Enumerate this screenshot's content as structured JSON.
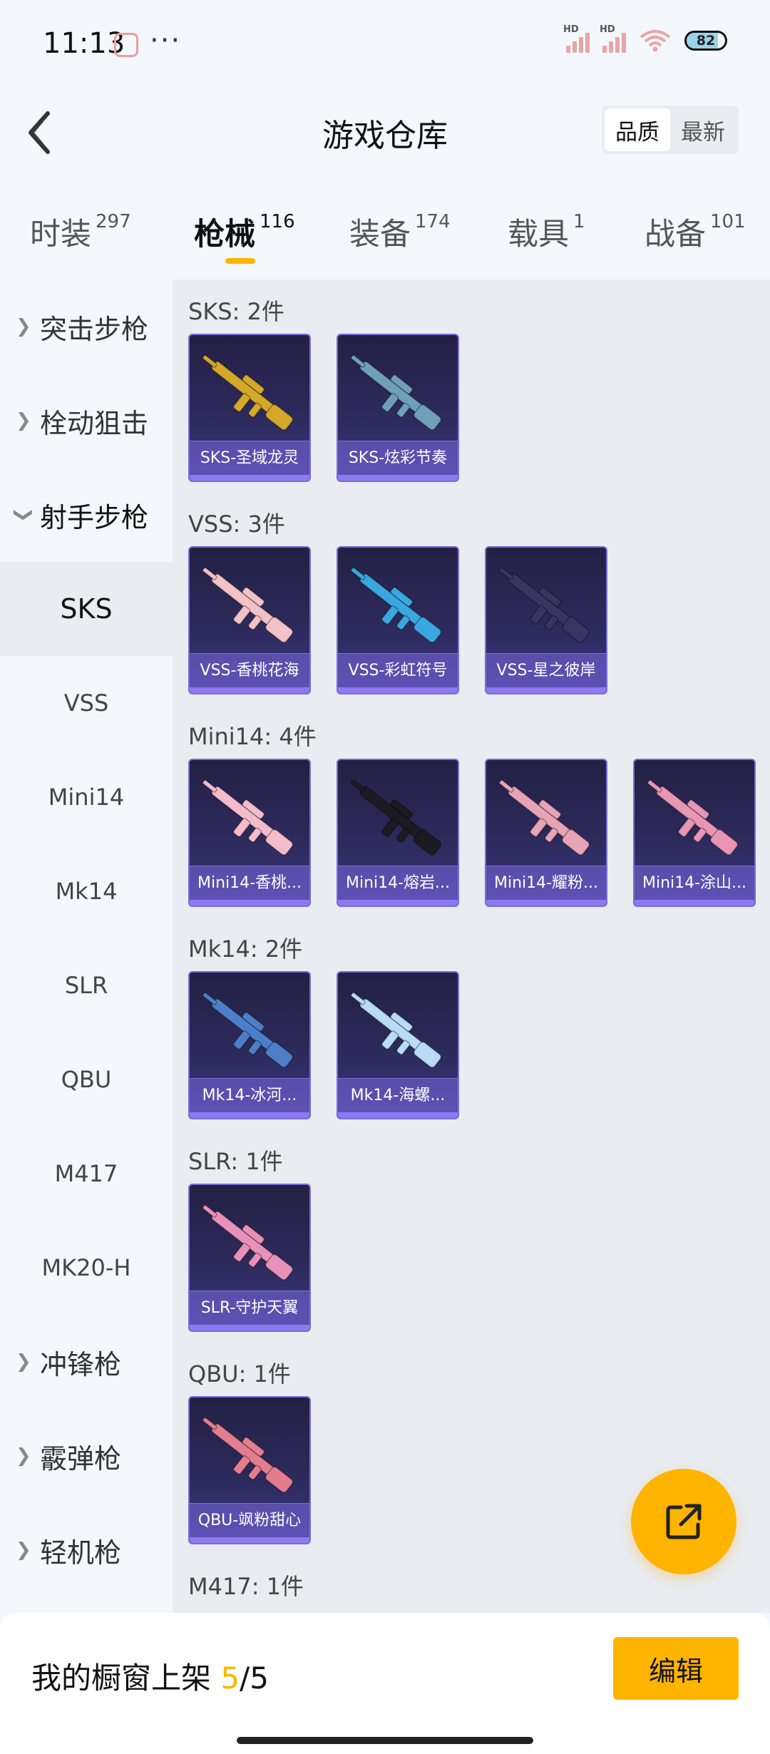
{
  "status": {
    "time": "11:13",
    "more": "···",
    "hd1": "HD",
    "hd2": "HD",
    "battery": "82"
  },
  "header": {
    "title": "游戏仓库",
    "sort_quality": "品质",
    "sort_latest": "最新"
  },
  "tabs": [
    {
      "name": "时装",
      "count": "297"
    },
    {
      "name": "枪械",
      "count": "116"
    },
    {
      "name": "装备",
      "count": "174"
    },
    {
      "name": "载具",
      "count": "1"
    },
    {
      "name": "战备",
      "count": "101"
    }
  ],
  "sidebar": {
    "items": [
      {
        "label": "突击步枪"
      },
      {
        "label": "栓动狙击"
      },
      {
        "label": "射手步枪"
      },
      {
        "label": "SKS"
      },
      {
        "label": "VSS"
      },
      {
        "label": "Mini14"
      },
      {
        "label": "Mk14"
      },
      {
        "label": "SLR"
      },
      {
        "label": "QBU"
      },
      {
        "label": "M417"
      },
      {
        "label": "MK20-H"
      },
      {
        "label": "冲锋枪"
      },
      {
        "label": "霰弹枪"
      },
      {
        "label": "轻机枪"
      }
    ]
  },
  "groups": [
    {
      "title": "SKS: 2件",
      "items": [
        {
          "label": "SKS-圣域龙灵",
          "color": "#d4a829"
        },
        {
          "label": "SKS-炫彩节奏",
          "color": "#6fa0b8"
        }
      ]
    },
    {
      "title": "VSS: 3件",
      "items": [
        {
          "label": "VSS-香桃花海",
          "color": "#f2c2c7"
        },
        {
          "label": "VSS-彩虹符号",
          "color": "#3aa7e0"
        },
        {
          "label": "VSS-星之彼岸",
          "color": "#3a3560"
        }
      ]
    },
    {
      "title": "Mini14: 4件",
      "items": [
        {
          "label": "Mini14-香桃...",
          "color": "#f4bccb"
        },
        {
          "label": "Mini14-熔岩...",
          "color": "#1e1a22"
        },
        {
          "label": "Mini14-耀粉...",
          "color": "#e6a4b6"
        },
        {
          "label": "Mini14-涂山...",
          "color": "#e995b4"
        }
      ]
    },
    {
      "title": "Mk14: 2件",
      "items": [
        {
          "label": "Mk14-冰河...",
          "color": "#4d7fc9"
        },
        {
          "label": "Mk14-海螺...",
          "color": "#b8dcf5"
        }
      ]
    },
    {
      "title": "SLR: 1件",
      "items": [
        {
          "label": "SLR-守护天翼",
          "color": "#e891b8"
        }
      ]
    },
    {
      "title": "QBU: 1件",
      "items": [
        {
          "label": "QBU-飒粉甜心",
          "color": "#e47e8e"
        }
      ]
    },
    {
      "title": "M417: 1件",
      "items": []
    }
  ],
  "bottom": {
    "showcase_label": "我的橱窗上架",
    "showcase_count": "5",
    "showcase_total": "/5",
    "edit_label": "编辑"
  }
}
